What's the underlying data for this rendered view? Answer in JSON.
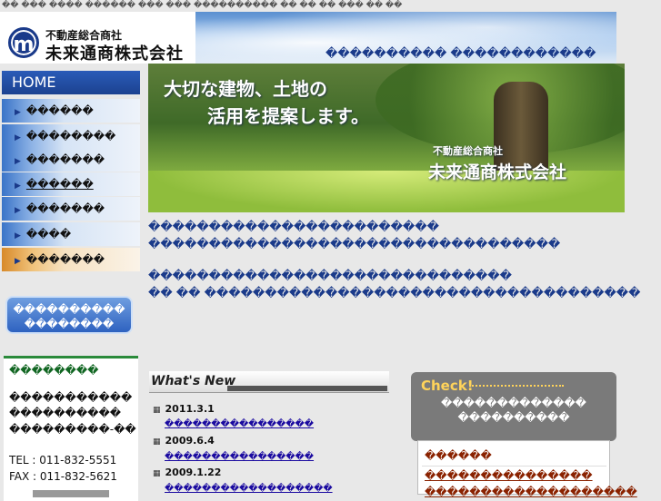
{
  "topstrip": "�� ��� ���� ������ ��� ��� ���������� �� �� �� ��� �� ��",
  "header": {
    "logo_letter": "m",
    "logo_sub": "不動産総合商社",
    "logo_main": "未来通商株式会社",
    "tagline": "���������� ������������"
  },
  "sidebar": {
    "home_label": "HOME",
    "items": [
      {
        "label": "������"
      },
      {
        "label": "��������"
      },
      {
        "label": "�������"
      },
      {
        "label": "������"
      },
      {
        "label": "�������"
      },
      {
        "label": "����"
      },
      {
        "label": "�������"
      }
    ],
    "pill_line1": "����������",
    "pill_line2": "��������",
    "info": {
      "title": "��������",
      "line1": "�����������",
      "line2": "����������",
      "line3": "���������-��",
      "tel": "TEL : 011-832-5551",
      "fax": "FAX : 011-832-5621"
    }
  },
  "hero": {
    "title1": "大切な建物、土地の",
    "title2": "活用を提案します。",
    "sub1": "不動産総合商社",
    "sub2": "未来通商株式会社"
  },
  "body": {
    "line1": "������������������������",
    "line2": "����������������������������������",
    "line3": "������������������������������",
    "line4": "�� �� ������������������������������������"
  },
  "news": {
    "heading": "What's New",
    "items": [
      {
        "date": "2011.3.1",
        "link": "����������������"
      },
      {
        "date": "2009.6.4",
        "link": "����������������"
      },
      {
        "date": "2009.1.22",
        "link": "������������������"
      }
    ]
  },
  "check": {
    "title": "Check!",
    "line1": "�������������",
    "line2": "����������",
    "box_title": "������",
    "link1": "���������������",
    "link2": "�������������������"
  },
  "colors": {
    "nav_blue": "#2a5bb8",
    "link_blue": "#1a0aa0",
    "green_rule": "#2a8a3a",
    "brown_text": "#8a2200",
    "check_yellow": "#ffd35a"
  }
}
